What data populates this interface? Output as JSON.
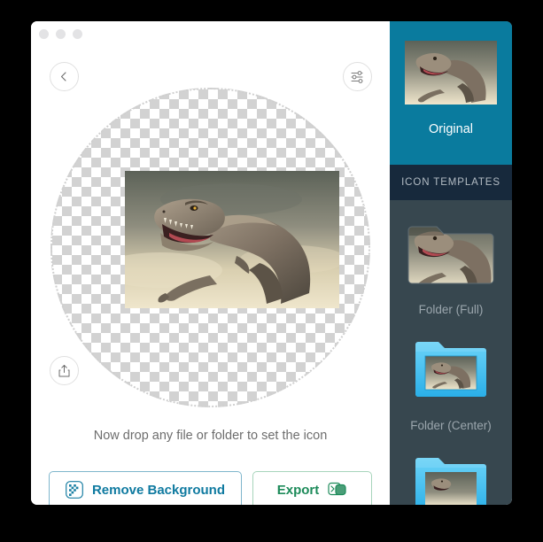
{
  "window": {
    "traffic_lights": [
      "close",
      "minimize",
      "maximize"
    ],
    "background_color": "#ffffff"
  },
  "toolbar": {
    "back_icon": "chevron-left-icon",
    "settings_icon": "sliders-icon",
    "share_icon": "share-upload-icon"
  },
  "canvas": {
    "transparency_checker": true,
    "image_alt": "tyrannosaurus-rex-roaring",
    "hint_text": "Now drop any file or folder to set the icon"
  },
  "actions": {
    "remove_background": {
      "label": "Remove Background",
      "icon": "checkerboard-icon",
      "color": "#0f7aa0",
      "border_color": "#7fb6cc"
    },
    "export": {
      "label": "Export",
      "icon": "export-icon",
      "color": "#1d8b5a",
      "border_color": "#a7d4bb"
    }
  },
  "sidebar": {
    "accent_color": "#0a7b9e",
    "background_color": "#37474f",
    "header_background_color": "#17293c",
    "original": {
      "label": "Original",
      "selected": true
    },
    "section_header": "ICON TEMPLATES",
    "templates": [
      {
        "label": "Folder (Full)",
        "style": "full"
      },
      {
        "label": "Folder (Center)",
        "style": "center"
      },
      {
        "label": "",
        "style": "center"
      }
    ]
  }
}
